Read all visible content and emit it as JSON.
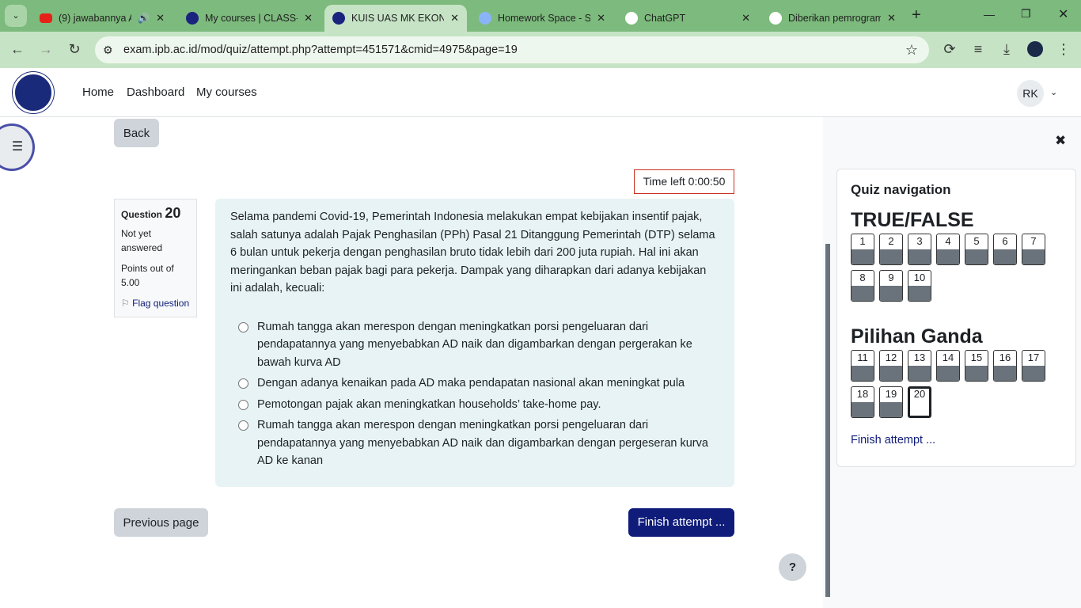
{
  "browser": {
    "tabs": [
      {
        "title": "(9) jawabannya A",
        "icon": "youtube-icon",
        "audio": true
      },
      {
        "title": "My courses | CLASS-I",
        "icon": "ipb-icon"
      },
      {
        "title": "KUIS UAS MK EKONO",
        "icon": "ipb-icon",
        "active": true
      },
      {
        "title": "Homework Space - S",
        "icon": "gem-icon"
      },
      {
        "title": "ChatGPT",
        "icon": "chatgpt-icon"
      },
      {
        "title": "Diberikan pemrogram",
        "icon": "google-icon"
      }
    ],
    "url": "exam.ipb.ac.id/mod/quiz/attempt.php?attempt=451571&cmid=4975&page=19"
  },
  "header": {
    "nav": [
      "Home",
      "Dashboard",
      "My courses"
    ],
    "user_initials": "RK"
  },
  "main": {
    "back": "Back",
    "timer": "Time left 0:00:50",
    "question": {
      "label": "Question",
      "number": "20",
      "status": "Not yet answered",
      "points": "Points out of 5.00",
      "flag": "Flag question",
      "text": "Selama pandemi Covid-19, Pemerintah Indonesia melakukan empat kebijakan insentif pajak, salah satunya adalah Pajak Penghasilan (PPh) Pasal 21 Ditanggung Pemerintah (DTP) selama 6 bulan untuk pekerja dengan penghasilan bruto tidak lebih dari 200 juta rupiah. Hal ini akan meringankan beban pajak bagi para pekerja. Dampak yang diharapkan dari adanya kebijakan ini adalah, kecuali:",
      "options": [
        "Rumah tangga akan merespon dengan meningkatkan porsi pengeluaran dari pendapatannya yang menyebabkan AD naik dan digambarkan dengan pergerakan ke bawah kurva AD",
        "Dengan adanya kenaikan pada AD maka pendapatan nasional akan meningkat pula",
        "Pemotongan pajak akan meningkatkan households’ take-home pay.",
        "Rumah tangga akan merespon dengan meningkatkan porsi pengeluaran dari pendapatannya yang menyebabkan AD naik dan digambarkan dengan pergeseran kurva AD ke kanan"
      ]
    },
    "prev": "Previous page",
    "finish": "Finish attempt ...",
    "help": "?"
  },
  "quiznav": {
    "title": "Quiz navigation",
    "sections": [
      {
        "name": "TRUE/FALSE",
        "questions": [
          "1",
          "2",
          "3",
          "4",
          "5",
          "6",
          "7",
          "8",
          "9",
          "10"
        ]
      },
      {
        "name": "Pilihan Ganda",
        "questions": [
          "11",
          "12",
          "13",
          "14",
          "15",
          "16",
          "17",
          "18",
          "19",
          "20"
        ]
      }
    ],
    "current": "20",
    "finish": "Finish attempt ..."
  },
  "colors": {
    "accent": "#0f1c7a",
    "answered": "#6a737b",
    "tabbar": "#7dba7d"
  }
}
